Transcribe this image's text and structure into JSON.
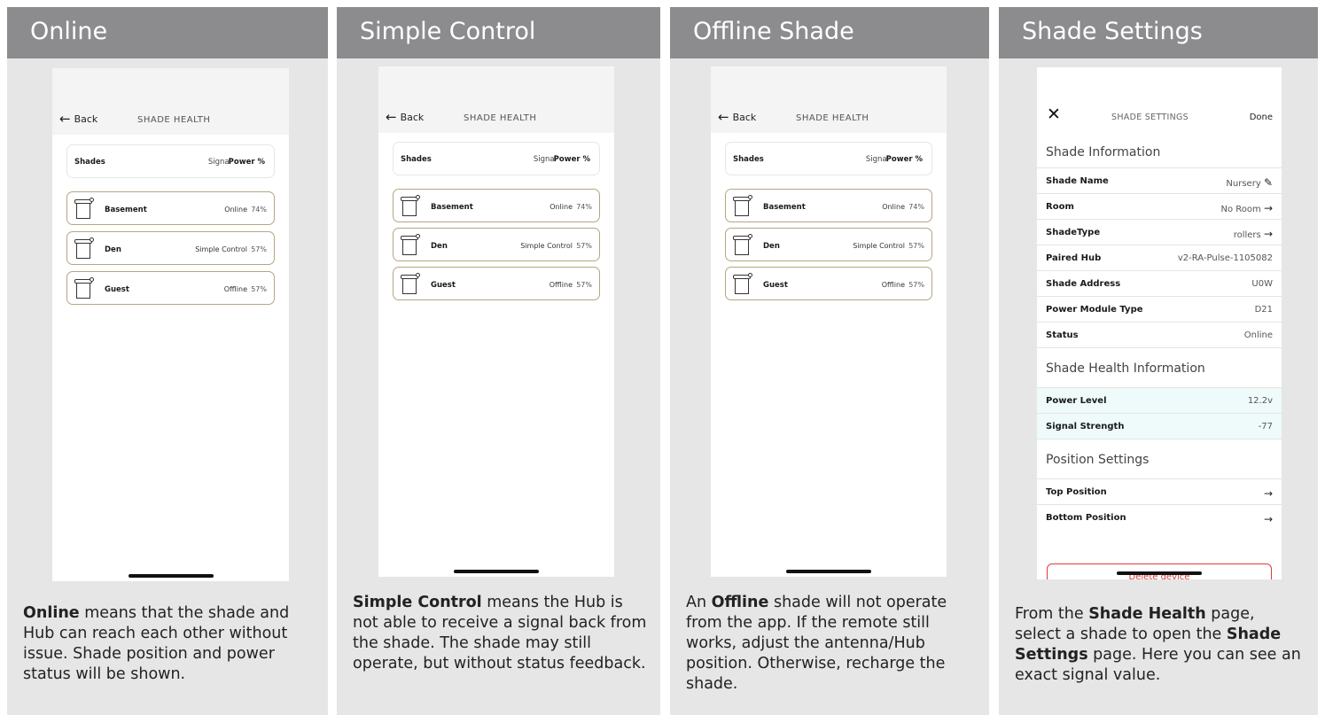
{
  "panels": [
    {
      "title": "Online",
      "desc": {
        "bold": "Online",
        "rest": " means that the shade and Hub can reach each other without issue. Shade position and power status will be shown."
      }
    },
    {
      "title": "Simple Control",
      "desc": {
        "bold": "Simple Control",
        "rest": " means the Hub is not able to receive a signal back from the shade. The shade may still operate, but without status feedback."
      }
    },
    {
      "title": "Offline Shade",
      "desc": {
        "pre": "An ",
        "bold": "Offline",
        "rest": " shade will not operate from the app. If the remote still works, adjust the antenna/Hub position. Otherwise, recharge the shade."
      }
    },
    {
      "title": "Shade Settings",
      "desc": {
        "pre": "From the ",
        "bold": "Shade Health",
        "mid": " page, select a shade to open the ",
        "bold2": "Shade Settings",
        "rest": " page. Here you can see an exact signal value."
      }
    }
  ],
  "health_screen": {
    "back": "Back",
    "title": "SHADE HEALTH",
    "header": {
      "shades": "Shades",
      "signal": "Signal",
      "power": "Power %"
    },
    "rows": [
      {
        "name": "Basement",
        "status": "Online",
        "power": "74%"
      },
      {
        "name": "Den",
        "status": "Simple Control",
        "power": "57%"
      },
      {
        "name": "Guest",
        "status": "Offline",
        "power": "57%"
      }
    ]
  },
  "settings_screen": {
    "title": "SHADE SETTINGS",
    "done": "Done",
    "sections": {
      "info": "Shade Information",
      "health": "Shade Health Information",
      "position": "Position Settings"
    },
    "info_rows": [
      {
        "key": "Shade Name",
        "value": "Nursery",
        "icon": "pencil-icon"
      },
      {
        "key": "Room",
        "value": "No Room",
        "icon": "arrow-right-icon"
      },
      {
        "key": "ShadeType",
        "value": "rollers",
        "icon": "arrow-right-icon"
      },
      {
        "key": "Paired Hub",
        "value": "v2-RA-Pulse-1105082"
      },
      {
        "key": "Shade Address",
        "value": "U0W"
      },
      {
        "key": "Power Module Type",
        "value": "D21"
      },
      {
        "key": "Status",
        "value": "Online"
      }
    ],
    "health_rows": [
      {
        "key": "Power Level",
        "value": "12.2v"
      },
      {
        "key": "Signal Strength",
        "value": "-77"
      }
    ],
    "position_rows": [
      {
        "key": "Top Position",
        "icon": "arrow-right-icon"
      },
      {
        "key": "Bottom Position",
        "icon": "arrow-right-icon"
      }
    ],
    "delete_label": "Delete device"
  },
  "colors": {
    "header_bg": "#8c8c8e",
    "panel_bg": "#e6e6e6",
    "row_border": "#b3a782",
    "highlight_row": "#eefbfa",
    "delete_red": "#e03a3a"
  }
}
